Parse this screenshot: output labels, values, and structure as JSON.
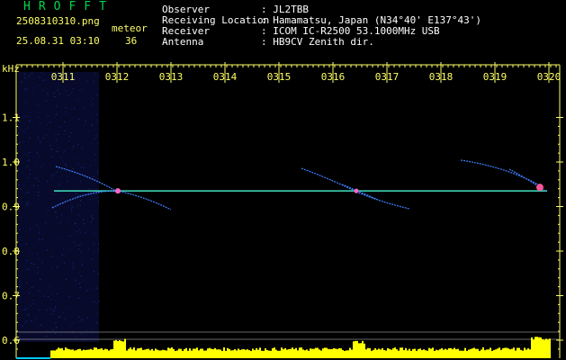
{
  "header": {
    "app_title": "HROFFT",
    "filename": "2508310310.png",
    "mode_label": "meteor",
    "timestamp": "25.08.31 03:10",
    "count": "36"
  },
  "info": {
    "rows": [
      {
        "label": "Observer",
        "value": ": JL2TBB"
      },
      {
        "label": "Receiving Location",
        "value": ": Hamamatsu, Japan (N34°40' E137°43')"
      },
      {
        "label": "Receiver",
        "value": ": ICOM IC-R2500 53.1000MHz USB"
      },
      {
        "label": "Antenna",
        "value": ": HB9CV Zenith dir."
      }
    ]
  },
  "chart_data": {
    "type": "heatmap",
    "ylabel": "kHz",
    "y_ticks": [
      "1.1",
      "1.0",
      "0.9",
      "0.8",
      "0.7",
      "0.6"
    ],
    "x_ticks": [
      "0311",
      "0312",
      "0313",
      "0314",
      "0315",
      "0316",
      "0317",
      "0318",
      "0319",
      "0320"
    ],
    "carrier_khz": 0.935,
    "colors": {
      "axis": "#ffff66",
      "carrier": "#40e0c0",
      "echo": "#4080ff",
      "level": "#ffff00",
      "baseline": "#00c8ff"
    }
  }
}
